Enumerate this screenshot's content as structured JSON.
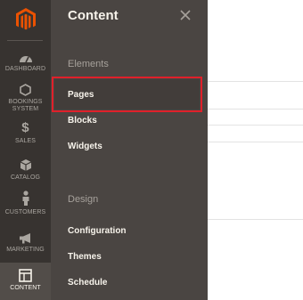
{
  "nav": {
    "items": [
      {
        "label": "DASHBOARD",
        "icon": "dashboard-icon"
      },
      {
        "label": "BOOKINGS SYSTEM",
        "icon": "hexagon-icon"
      },
      {
        "label": "SALES",
        "icon": "dollar-icon"
      },
      {
        "label": "CATALOG",
        "icon": "cube-icon"
      },
      {
        "label": "CUSTOMERS",
        "icon": "person-icon"
      },
      {
        "label": "MARKETING",
        "icon": "megaphone-icon"
      },
      {
        "label": "CONTENT",
        "icon": "layout-icon"
      }
    ],
    "logo_color": "#eb5202",
    "active": "CONTENT"
  },
  "panel": {
    "title": "Content",
    "sections": [
      {
        "title": "Elements",
        "links": [
          "Pages",
          "Blocks",
          "Widgets"
        ]
      },
      {
        "title": "Design",
        "links": [
          "Configuration",
          "Themes",
          "Schedule"
        ]
      }
    ],
    "highlighted_link": "Pages",
    "highlight_color": "#e0202a"
  }
}
